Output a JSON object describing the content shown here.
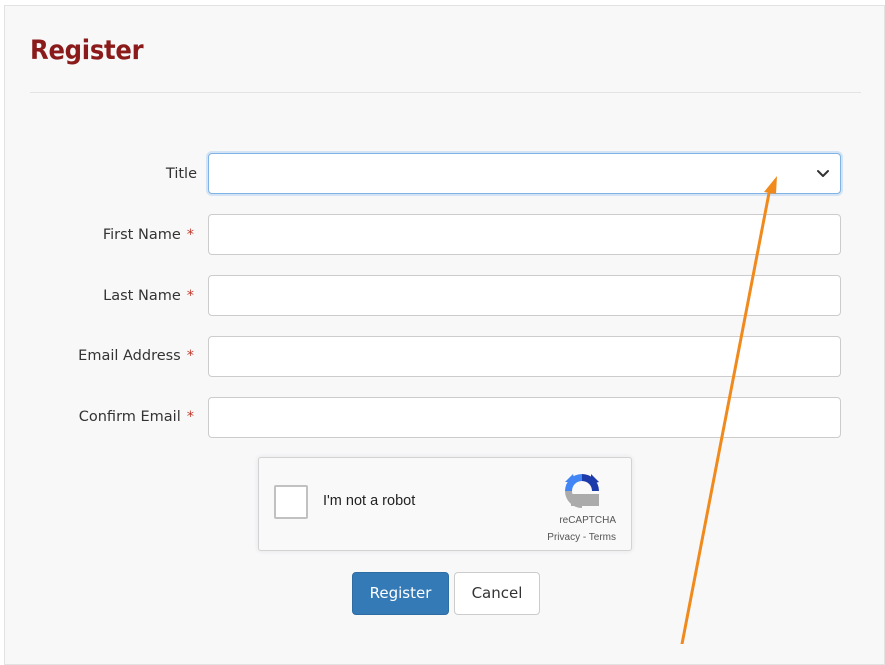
{
  "page": {
    "title": "Register"
  },
  "form": {
    "fields": [
      {
        "label": "Title",
        "required": false,
        "value": "",
        "type": "select"
      },
      {
        "label": "First Name",
        "required": true,
        "value": "",
        "type": "text"
      },
      {
        "label": "Last Name",
        "required": true,
        "value": "",
        "type": "text"
      },
      {
        "label": "Email Address",
        "required": true,
        "value": "",
        "type": "text"
      },
      {
        "label": "Confirm Email",
        "required": true,
        "value": "",
        "type": "text"
      }
    ],
    "required_marker": "*"
  },
  "captcha": {
    "checkbox_label": "I'm not a robot",
    "brand": "reCAPTCHA",
    "links": "Privacy - Terms",
    "icon": "recaptcha-logo-icon"
  },
  "actions": {
    "register_label": "Register",
    "cancel_label": "Cancel"
  },
  "colors": {
    "title": "#8b1a1a",
    "required": "#c0392b",
    "primary_button": "#337ab7",
    "annotation_arrow": "#f08a1c"
  }
}
